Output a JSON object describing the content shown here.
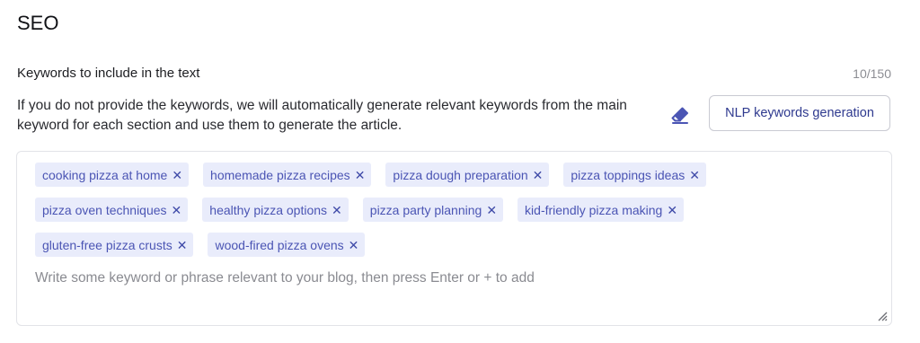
{
  "section": {
    "title": "SEO"
  },
  "keywords": {
    "label": "Keywords to include in the text",
    "counter": "10/150",
    "description": "If you do not provide the keywords, we will automatically generate relevant keywords from the main keyword for each section and use them to generate the article.",
    "clear_icon": "eraser-icon",
    "nlp_button_label": "NLP keywords generation",
    "remove_glyph": "✕",
    "tags": [
      [
        "cooking pizza at home",
        "homemade pizza recipes",
        "pizza dough preparation",
        "pizza toppings ideas"
      ],
      [
        "pizza oven techniques",
        "healthy pizza options",
        "pizza party planning",
        "kid-friendly pizza making"
      ],
      [
        "gluten-free pizza crusts",
        "wood-fired pizza ovens"
      ]
    ],
    "input_placeholder": "Write some keyword or phrase relevant to your blog, then press Enter or + to add",
    "input_value": "",
    "accent_color": "#4b55b4",
    "tag_background": "#e9ecfb"
  }
}
